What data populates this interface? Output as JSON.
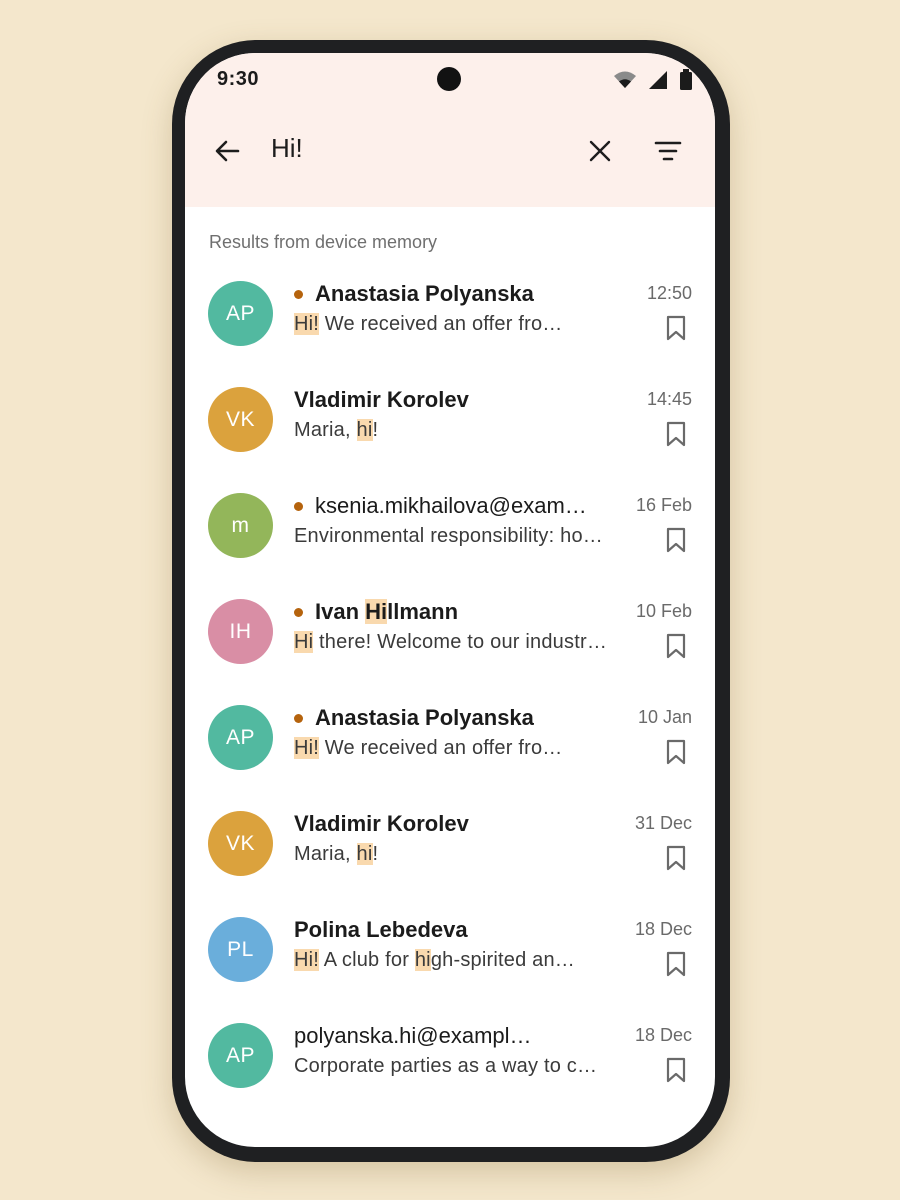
{
  "status_bar": {
    "time": "9:30"
  },
  "search": {
    "query": "Hi!"
  },
  "section_label": "Results from device memory",
  "colors": {
    "teal": "#52b9a0",
    "amber": "#dba23d",
    "green": "#93b65a",
    "pink": "#d98ea5",
    "blue": "#6aaedb",
    "unread_dot": "#b5630d",
    "highlight": "#f9d9ae",
    "header_bg": "#fdf0eb"
  },
  "messages": [
    {
      "initials": "AP",
      "avatar_color": "#52b9a0",
      "unread": true,
      "sender_parts": [
        {
          "text": "Anastasia Polyanska",
          "hl": false
        }
      ],
      "sender_bold": true,
      "time": "12:50",
      "preview_parts": [
        {
          "text": "Hi!",
          "hl": true
        },
        {
          "text": " We received an offer fro…",
          "hl": false
        }
      ]
    },
    {
      "initials": "VK",
      "avatar_color": "#dba23d",
      "unread": false,
      "sender_parts": [
        {
          "text": "Vladimir Korolev",
          "hl": false
        }
      ],
      "sender_bold": true,
      "time": "14:45",
      "preview_parts": [
        {
          "text": "Maria, ",
          "hl": false
        },
        {
          "text": "hi",
          "hl": true
        },
        {
          "text": "!",
          "hl": false
        }
      ]
    },
    {
      "initials": "m",
      "avatar_color": "#93b65a",
      "unread": true,
      "sender_parts": [
        {
          "text": "ksenia.mikhailova@examp…",
          "hl": false
        }
      ],
      "sender_bold": false,
      "time": "16 Feb",
      "preview_parts": [
        {
          "text": "Environmental responsibility: ho…",
          "hl": false
        }
      ]
    },
    {
      "initials": "IH",
      "avatar_color": "#d98ea5",
      "unread": true,
      "sender_parts": [
        {
          "text": "Ivan ",
          "hl": false
        },
        {
          "text": "Hi",
          "hl": true
        },
        {
          "text": "llmann",
          "hl": false
        }
      ],
      "sender_bold": true,
      "time": "10 Feb",
      "preview_parts": [
        {
          "text": "Hi",
          "hl": true
        },
        {
          "text": " there! Welcome to our industr…",
          "hl": false
        }
      ]
    },
    {
      "initials": "AP",
      "avatar_color": "#52b9a0",
      "unread": true,
      "sender_parts": [
        {
          "text": "Anastasia Polyanska",
          "hl": false
        }
      ],
      "sender_bold": true,
      "time": "10 Jan",
      "preview_parts": [
        {
          "text": "Hi!",
          "hl": true
        },
        {
          "text": " We received an offer fro…",
          "hl": false
        }
      ]
    },
    {
      "initials": "VK",
      "avatar_color": "#dba23d",
      "unread": false,
      "sender_parts": [
        {
          "text": "Vladimir Korolev",
          "hl": false
        }
      ],
      "sender_bold": true,
      "time": "31 Dec",
      "preview_parts": [
        {
          "text": "Maria, ",
          "hl": false
        },
        {
          "text": "hi",
          "hl": true
        },
        {
          "text": "!",
          "hl": false
        }
      ]
    },
    {
      "initials": "PL",
      "avatar_color": "#6aaedb",
      "unread": false,
      "sender_parts": [
        {
          "text": "Polina Lebedeva",
          "hl": false
        }
      ],
      "sender_bold": true,
      "time": "18 Dec",
      "preview_parts": [
        {
          "text": "Hi!",
          "hl": true
        },
        {
          "text": " A club for ",
          "hl": false
        },
        {
          "text": "hi",
          "hl": true
        },
        {
          "text": "gh-spirited an…",
          "hl": false
        }
      ]
    },
    {
      "initials": "AP",
      "avatar_color": "#52b9a0",
      "unread": false,
      "sender_parts": [
        {
          "text": "polyanska.hi@exampl…",
          "hl": false
        }
      ],
      "sender_bold": false,
      "time": "18 Dec",
      "preview_parts": [
        {
          "text": "Corporate parties as a way to c…",
          "hl": false
        }
      ]
    }
  ],
  "icons": {
    "back": "arrow-left-icon",
    "clear": "close-icon",
    "filter": "filter-icon",
    "bookmark": "bookmark-icon",
    "wifi": "wifi-icon",
    "signal": "signal-icon",
    "battery": "battery-icon"
  }
}
